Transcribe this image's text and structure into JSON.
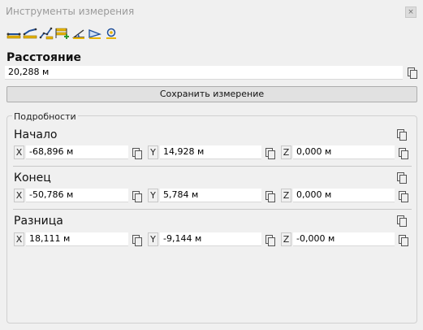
{
  "window": {
    "title": "Инструменты измерения",
    "close_glyph": "×"
  },
  "toolbar": {
    "tools": [
      {
        "icon": "measure-distance-icon"
      },
      {
        "icon": "measure-polyline-icon"
      },
      {
        "icon": "measure-path-icon"
      },
      {
        "icon": "measure-add-points-icon"
      },
      {
        "icon": "measure-angle-icon"
      },
      {
        "icon": "measure-area-icon"
      },
      {
        "icon": "measure-point-icon"
      }
    ]
  },
  "distance": {
    "label": "Расстояние",
    "value": "20,288 м"
  },
  "save_button": "Сохранить измерение",
  "details": {
    "legend": "Подробности",
    "start": {
      "label": "Начало",
      "x": "-68,896 м",
      "y": "14,928 м",
      "z": "0,000 м"
    },
    "end": {
      "label": "Конец",
      "x": "-50,786 м",
      "y": "5,784 м",
      "z": "0,000 м"
    },
    "difference": {
      "label": "Разница",
      "x": "18,111 м",
      "y": "-9,144 м",
      "z": "-0,000 м"
    },
    "axis_labels": {
      "x": "X",
      "y": "Y",
      "z": "Z"
    }
  },
  "colors": {
    "background": "#f0f0f0",
    "title_text": "#9a9a9a",
    "tool_yellow": "#e8b400",
    "tool_blue": "#1f4f9a",
    "tool_green": "#2e9a2e"
  }
}
